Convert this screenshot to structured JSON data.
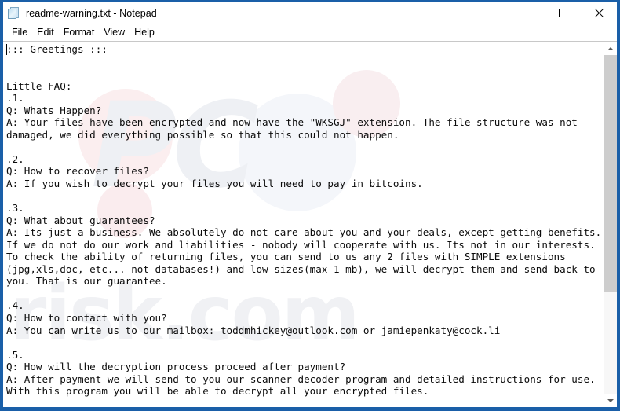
{
  "window": {
    "title": "readme-warning.txt - Notepad",
    "app_icon": "notepad-document-icon",
    "controls": {
      "minimize_label": "Minimize",
      "maximize_label": "Maximize",
      "close_label": "Close"
    },
    "frame_color": "#1a5fa8",
    "background_color": "#ffffff"
  },
  "menubar": {
    "items": [
      {
        "label": "File"
      },
      {
        "label": "Edit"
      },
      {
        "label": "Format"
      },
      {
        "label": "View"
      },
      {
        "label": "Help"
      }
    ]
  },
  "watermark": {
    "primary": "PC",
    "secondary": "risk.com",
    "color": "#eceef2"
  },
  "document": {
    "filename": "readme-warning.txt",
    "ransom_note_extension": "WKSGJ",
    "contact_emails": [
      "toddmhickey@outlook.com",
      "jamiepenkaty@cock.li"
    ],
    "body": "::: Greetings :::\n\n\nLittle FAQ:\n.1.\nQ: Whats Happen?\nA: Your files have been encrypted and now have the \"WKSGJ\" extension. The file structure was not\ndamaged, we did everything possible so that this could not happen.\n\n.2.\nQ: How to recover files?\nA: If you wish to decrypt your files you will need to pay in bitcoins.\n\n.3.\nQ: What about guarantees?\nA: Its just a business. We absolutely do not care about you and your deals, except getting benefits.\nIf we do not do our work and liabilities - nobody will cooperate with us. Its not in our interests.\nTo check the ability of returning files, you can send to us any 2 files with SIMPLE extensions\n(jpg,xls,doc, etc... not databases!) and low sizes(max 1 mb), we will decrypt them and send back to\nyou. That is our guarantee.\n\n.4.\nQ: How to contact with you?\nA: You can write us to our mailbox: toddmhickey@outlook.com or jamiepenkaty@cock.li\n\n.5.\nQ: How will the decryption process proceed after payment?\nA: After payment we will send to you our scanner-decoder program and detailed instructions for use.\nWith this program you will be able to decrypt all your encrypted files."
  },
  "scrollbar": {
    "up_arrow": "chevron-up-icon",
    "down_arrow": "chevron-down-icon",
    "thumb_size_percent": 70,
    "thumb_position_percent": 0
  }
}
